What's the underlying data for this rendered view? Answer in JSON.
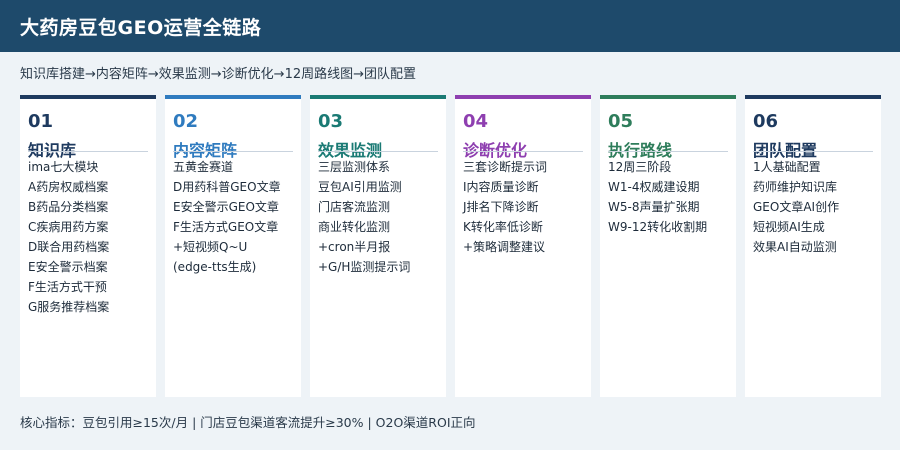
{
  "header": {
    "title": "大药房豆包GEO运营全链路"
  },
  "subtitle": "知识库搭建→内容矩阵→效果监测→诊断优化→12周路线图→团队配置",
  "cards": [
    {
      "num": "01",
      "title": "知识库",
      "color": "#1e3a5f",
      "items": [
        "ima七大模块",
        "A药房权威档案",
        "B药品分类档案",
        "C疾病用药方案",
        "D联合用药档案",
        "E安全警示档案",
        "F生活方式干预",
        "G服务推荐档案"
      ]
    },
    {
      "num": "02",
      "title": "内容矩阵",
      "color": "#2f7bbf",
      "items": [
        "五黄金赛道",
        "D用药科普GEO文章",
        "E安全警示GEO文章",
        "F生活方式GEO文章",
        "+短视频Q~U",
        "(edge-tts生成)"
      ]
    },
    {
      "num": "03",
      "title": "效果监测",
      "color": "#1a7a74",
      "items": [
        "三层监测体系",
        "豆包AI引用监测",
        "门店客流监测",
        "商业转化监测",
        "+cron半月报",
        "+G/H监测提示词"
      ]
    },
    {
      "num": "04",
      "title": "诊断优化",
      "color": "#8e3fb0",
      "items": [
        "三套诊断提示词",
        "I内容质量诊断",
        "J排名下降诊断",
        "K转化率低诊断",
        "+策略调整建议"
      ]
    },
    {
      "num": "05",
      "title": "执行路线",
      "color": "#2e7d5b",
      "items": [
        "12周三阶段",
        "W1-4权威建设期",
        "W5-8声量扩张期",
        "W9-12转化收割期"
      ]
    },
    {
      "num": "06",
      "title": "团队配置",
      "color": "#1e3a5f",
      "items": [
        "1人基础配置",
        "药师维护知识库",
        "GEO文章AI创作",
        "短视频AI生成",
        "效果AI自动监测"
      ]
    }
  ],
  "footer": "核心指标：豆包引用≥15次/月 | 门店豆包渠道客流提升≥30% | O2O渠道ROI正向"
}
